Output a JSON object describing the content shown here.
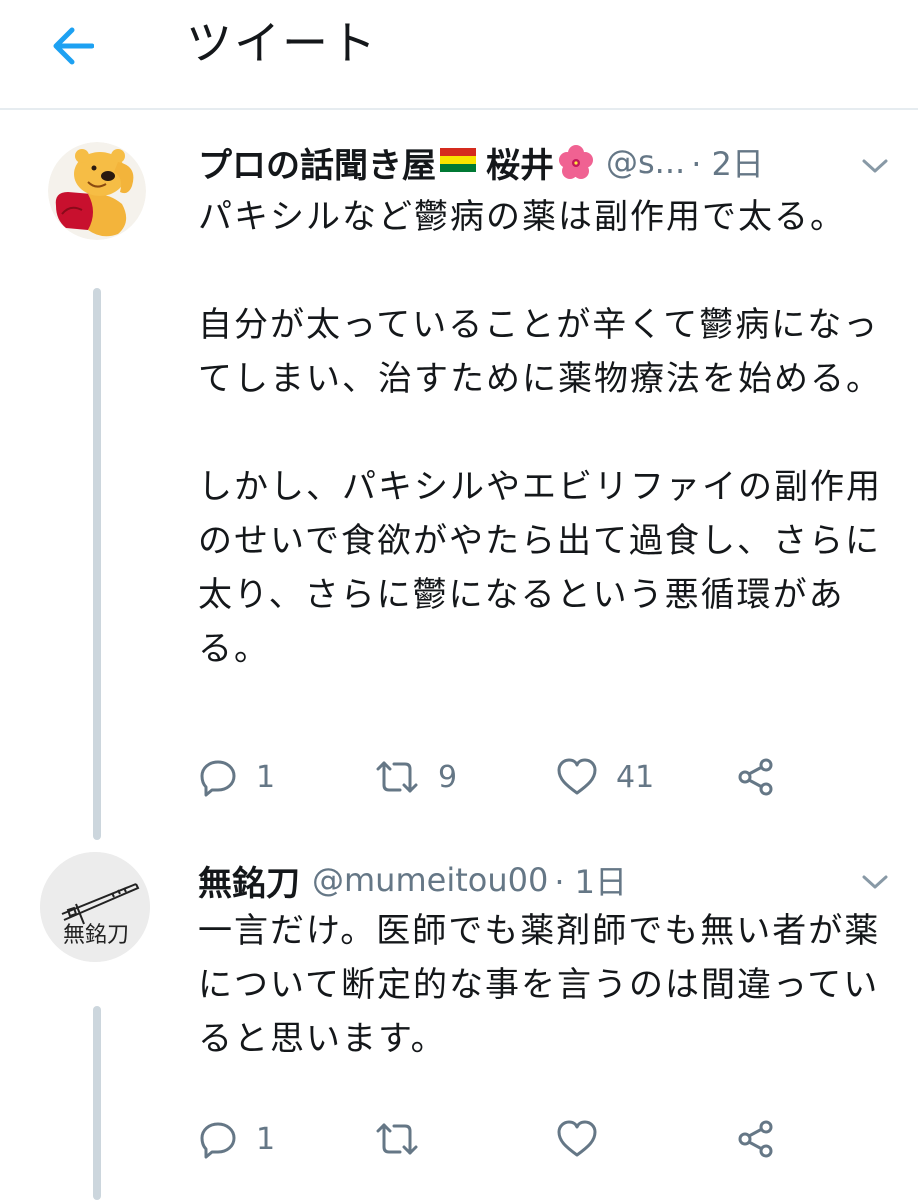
{
  "header": {
    "title": "ツイート"
  },
  "colors": {
    "accent": "#1da1f2",
    "muted": "#657786",
    "thread_line": "#ccd6dd"
  },
  "tweets": [
    {
      "name_part1": "プロの話聞き屋",
      "name_part2": "桜井",
      "handle": "@s...",
      "time": "· 2日",
      "text": "パキシルなど鬱病の薬は副作用で太る。\n\n自分が太っていることが辛くて鬱病になってしまい、治すために薬物療法を始める。\n\nしかし、パキシルやエビリファイの副作用のせいで食欲がやたら出て過食し、さらに太り、さらに鬱になるという悪循環がある。",
      "reply_count": "1",
      "retweet_count": "9",
      "like_count": "41",
      "avatar_icon": "winnie-the-pooh-avatar",
      "emoji_icons": [
        "bolivia-flag-icon",
        "hibiscus-icon"
      ]
    },
    {
      "name": "無銘刀",
      "handle": "@mumeitou00",
      "time": "· 1日",
      "text": "一言だけ。医師でも薬剤師でも無い者が薬について断定的な事を言うのは間違っていると思います。",
      "reply_count": "1",
      "avatar_text": "無銘刀",
      "avatar_icon": "sword-avatar"
    }
  ]
}
